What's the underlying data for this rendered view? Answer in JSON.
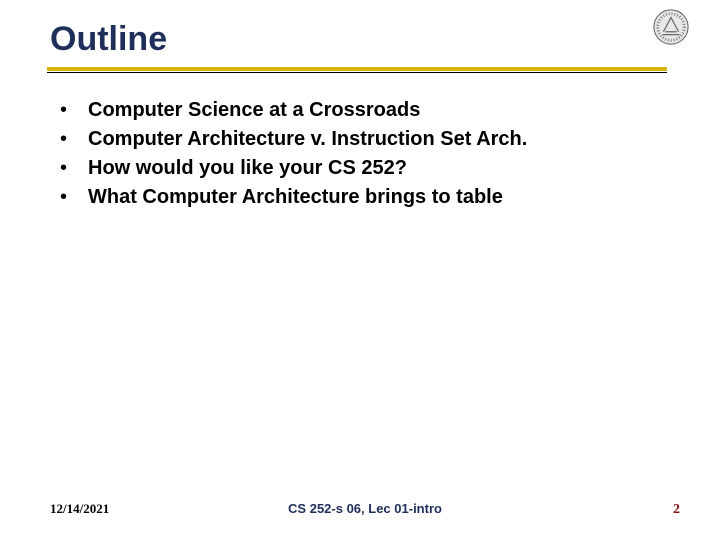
{
  "title": "Outline",
  "bullets": [
    "Computer Science at a Crossroads",
    "Computer Architecture v. Instruction Set Arch.",
    "How would you like your CS 252?",
    "What Computer Architecture brings to table"
  ],
  "footer": {
    "date": "12/14/2021",
    "center": "CS 252-s 06, Lec 01-intro",
    "page": "2"
  }
}
